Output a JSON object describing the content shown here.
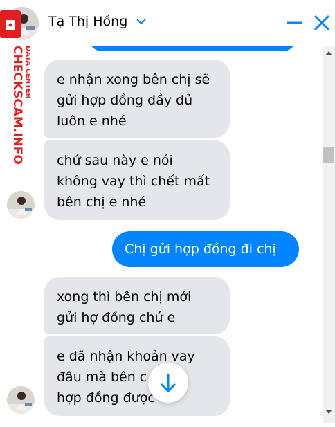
{
  "header": {
    "contact_name": "Tạ Thị Hồng"
  },
  "watermark": {
    "line1": "DATA CENTER",
    "line2": "CHECKSCAM.INFO"
  },
  "messages": [
    {
      "text": "e nhận xong bên chị sẽ\ngửi hợp đồng đầy đủ\nluôn e nhé"
    },
    {
      "text": "chứ sau này e nói\nkhông vay thì chết mất\nbên chị e nhé"
    },
    {
      "text": "Chị gửi hợp đồng đi chị"
    },
    {
      "text": "xong thì bên chị mới\ngửi hợ đồng chứ e"
    },
    {
      "text": "e đã nhận khoản vay\nđâu mà bên c\nhợp đồng được"
    }
  ],
  "colors": {
    "accent": "#0084ff",
    "incoming_bubble": "#e4e6eb",
    "watermark_red": "#e02020"
  }
}
